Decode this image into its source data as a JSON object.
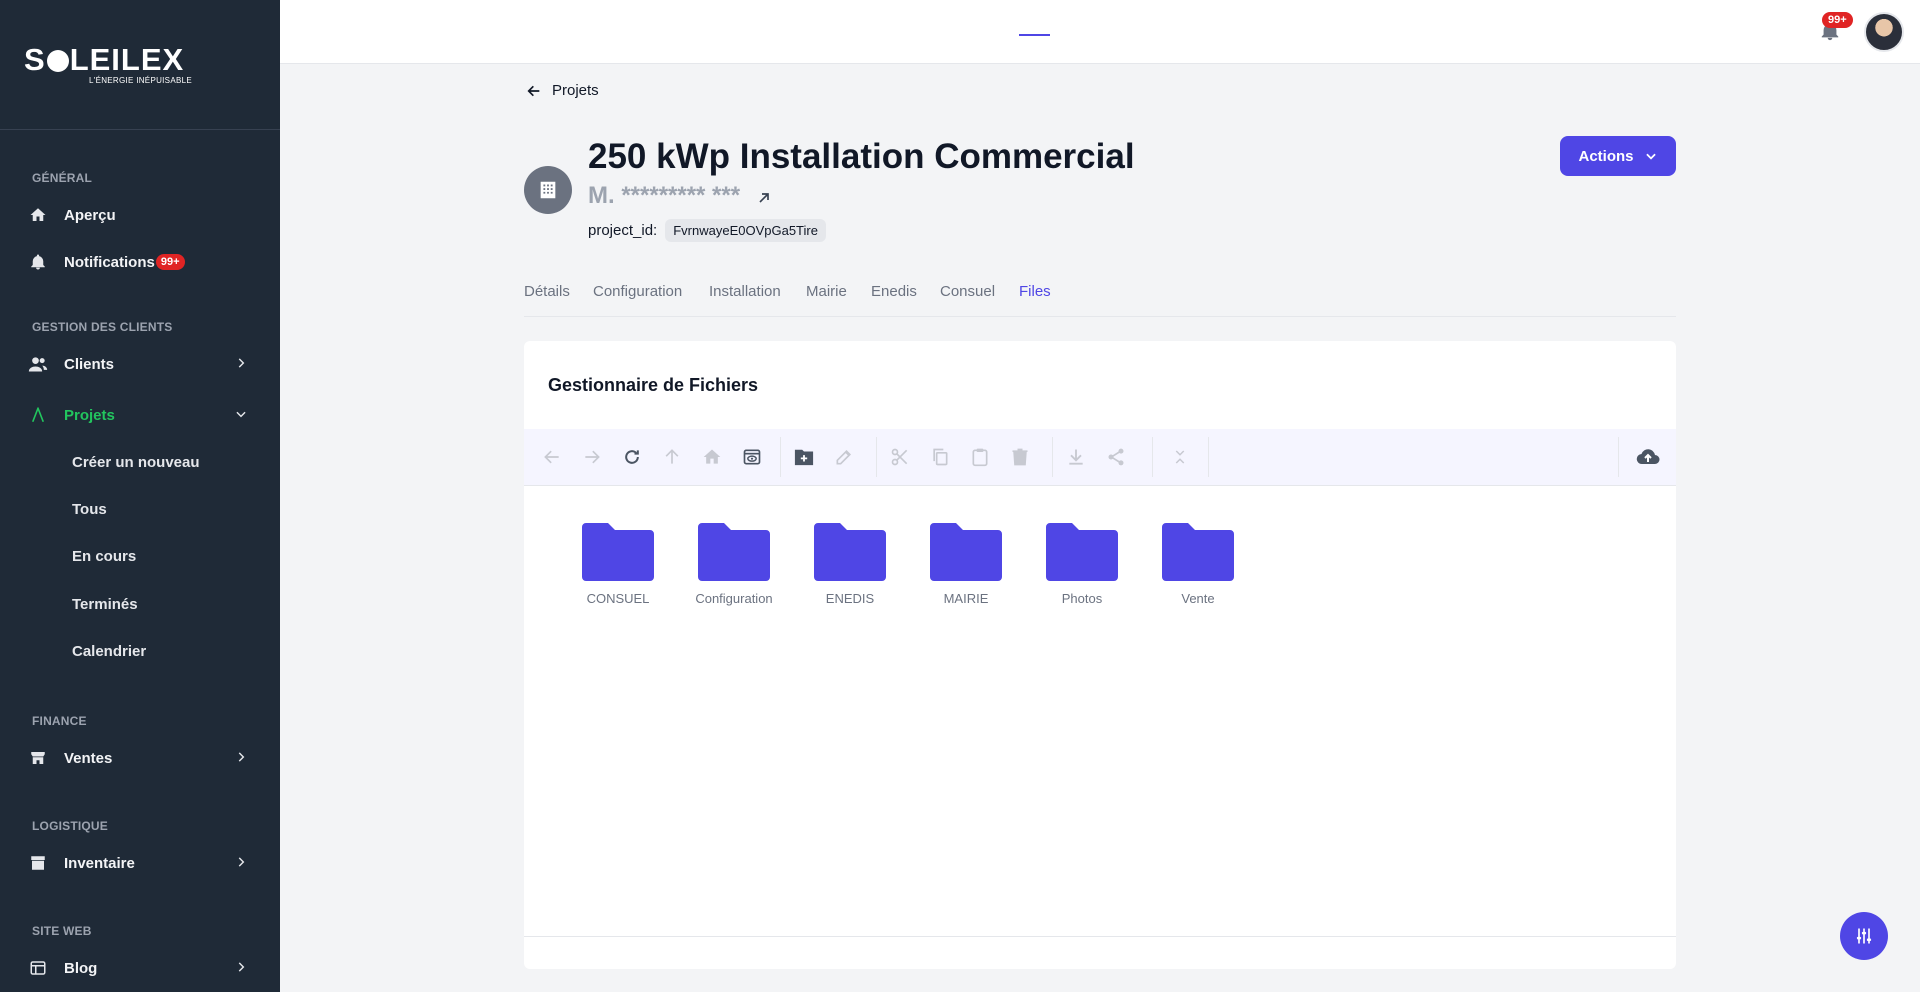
{
  "sidebar": {
    "logo": {
      "text_a": "S",
      "text_b": "LEILEX",
      "tagline": "L'ÉNERGIE INÉPUISABLE"
    },
    "sections": {
      "general": "GÉNÉRAL",
      "clients": "GESTION DES CLIENTS",
      "finance": "FINANCE",
      "logistique": "LOGISTIQUE",
      "site_web": "SITE WEB"
    },
    "items": {
      "apercu": "Aperçu",
      "notifications": "Notifications",
      "notifications_badge": "99+",
      "clients": "Clients",
      "projets": "Projets",
      "creer": "Créer un nouveau",
      "tous": "Tous",
      "en_cours": "En cours",
      "termines": "Terminés",
      "calendrier": "Calendrier",
      "ventes": "Ventes",
      "inventaire": "Inventaire",
      "blog": "Blog"
    }
  },
  "topbar": {
    "notification_badge": "99+"
  },
  "header": {
    "back_label": "Projets",
    "title": "250 kWp Installation Commercial",
    "client": "M. ********* ***",
    "project_id_label": "project_id:",
    "project_id_value": "FvrnwayeE0OVpGa5Tire",
    "actions_label": "Actions"
  },
  "tabs": [
    "Détails",
    "Configuration",
    "Installation",
    "Mairie",
    "Enedis",
    "Consuel",
    "Files"
  ],
  "active_tab": "Files",
  "file_manager": {
    "title": "Gestionnaire de Fichiers",
    "folders": [
      "CONSUEL",
      "Configuration",
      "ENEDIS",
      "MAIRIE",
      "Photos",
      "Vente"
    ],
    "folder_color": "#4f46e5"
  },
  "colors": {
    "accent": "#4f46e5",
    "sidebar_bg": "#1f2a37",
    "active_nav": "#22c55e",
    "badge": "#e02424"
  }
}
